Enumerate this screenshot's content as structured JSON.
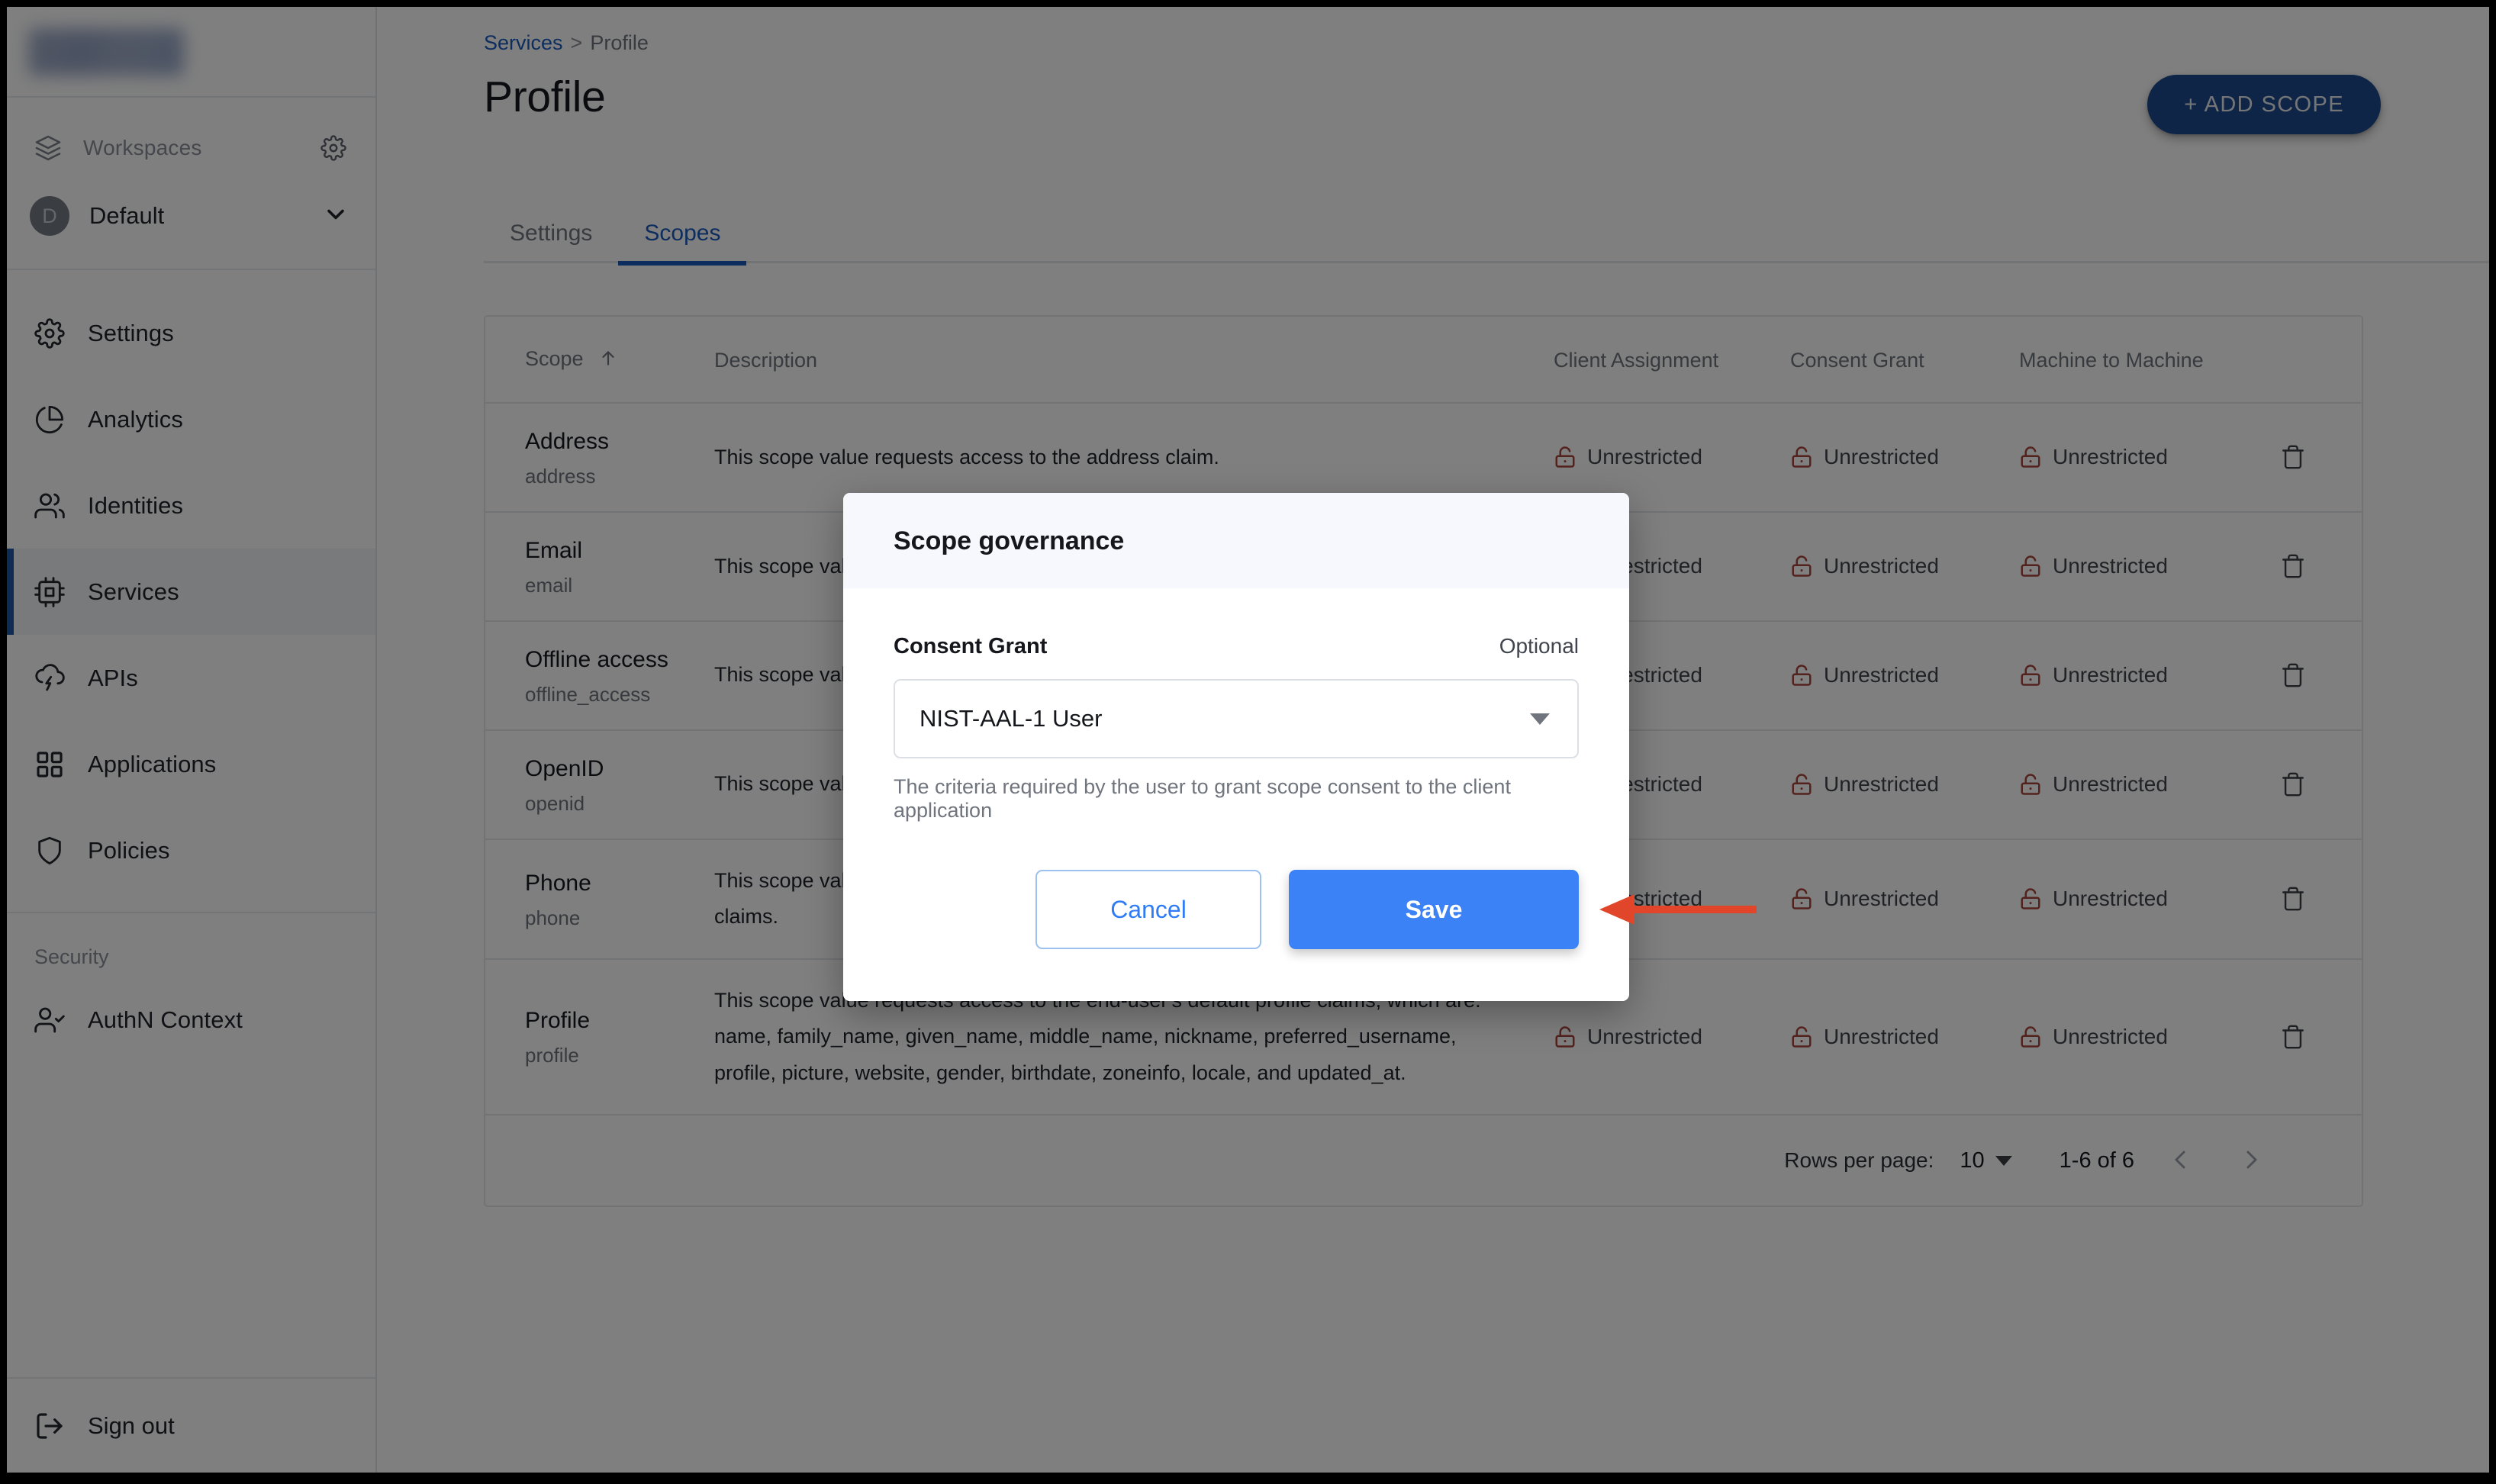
{
  "sidebar": {
    "brand": {
      "logo_name": "app-logo-blurred"
    },
    "workspaces": {
      "label": "Workspaces",
      "gear_icon": "gear-icon",
      "layers_icon": "layers-icon"
    },
    "workspace_selector": {
      "avatar_initial": "D",
      "name": "Default",
      "caret_icon": "chevron-down-icon"
    },
    "nav_items": [
      {
        "label": "Settings",
        "icon": "gear-icon",
        "active": false
      },
      {
        "label": "Analytics",
        "icon": "pie-chart-icon",
        "active": false
      },
      {
        "label": "Identities",
        "icon": "users-icon",
        "active": false
      },
      {
        "label": "Services",
        "icon": "chip-icon",
        "active": true
      },
      {
        "label": "APIs",
        "icon": "cloud-bolt-icon",
        "active": false
      },
      {
        "label": "Applications",
        "icon": "grid-icon",
        "active": false
      },
      {
        "label": "Policies",
        "icon": "shield-icon",
        "active": false
      }
    ],
    "security_section": {
      "title": "Security",
      "items": [
        {
          "label": "AuthN Context",
          "icon": "user-check-icon"
        }
      ]
    },
    "signout": {
      "label": "Sign out",
      "icon": "sign-out-icon"
    }
  },
  "header": {
    "breadcrumb": {
      "parent": "Services",
      "separator": ">",
      "current": "Profile"
    },
    "title": "Profile",
    "add_scope_label": "+ ADD SCOPE"
  },
  "tabs": [
    {
      "label": "Settings",
      "active": false
    },
    {
      "label": "Scopes",
      "active": true
    }
  ],
  "table": {
    "columns": [
      {
        "key": "scope",
        "label": "Scope",
        "sort_icon": "arrow-up-icon",
        "sorted": true
      },
      {
        "key": "description",
        "label": "Description"
      },
      {
        "key": "client_assignment",
        "label": "Client Assignment"
      },
      {
        "key": "consent_grant",
        "label": "Consent Grant"
      },
      {
        "key": "machine_to_machine",
        "label": "Machine to Machine"
      }
    ],
    "unlock_icon": "unlock-icon",
    "delete_icon": "trash-icon",
    "rows": [
      {
        "name": "Address",
        "key": "address",
        "description": "This scope value requests access to the address claim.",
        "client_assignment": "Unrestricted",
        "consent_grant": "Unrestricted",
        "machine_to_machine": "Unrestricted"
      },
      {
        "name": "Email",
        "key": "email",
        "description": "This scope val",
        "client_assignment": "Unrestricted",
        "consent_grant": "Unrestricted",
        "machine_to_machine": "Unrestricted"
      },
      {
        "name": "Offline access",
        "key": "offline_access",
        "description": "This scope val",
        "client_assignment": "Unrestricted",
        "consent_grant": "Unrestricted",
        "machine_to_machine": "Unrestricted"
      },
      {
        "name": "OpenID",
        "key": "openid",
        "description": "This scope val",
        "client_assignment": "Unrestricted",
        "consent_grant": "Unrestricted",
        "machine_to_machine": "Unrestricted"
      },
      {
        "name": "Phone",
        "key": "phone",
        "description": "This scope val\nclaims.",
        "client_assignment": "Unrestricted",
        "consent_grant": "Unrestricted",
        "machine_to_machine": "Unrestricted"
      },
      {
        "name": "Profile",
        "key": "profile",
        "description": "This scope value requests access to the end-user's default profile claims, which are: name, family_name, given_name, middle_name, nickname, preferred_username, profile, picture, website, gender, birthdate, zoneinfo, locale, and updated_at.",
        "client_assignment": "Unrestricted",
        "consent_grant": "Unrestricted",
        "machine_to_machine": "Unrestricted"
      }
    ],
    "footer": {
      "rows_per_page_label": "Rows per page:",
      "rows_per_page_value": "10",
      "range_label": "1-6 of 6",
      "prev_icon": "chevron-left-icon",
      "next_icon": "chevron-right-icon"
    }
  },
  "modal": {
    "title": "Scope governance",
    "field_label": "Consent Grant",
    "field_optional": "Optional",
    "select_value": "NIST-AAL-1 User",
    "select_caret_icon": "caret-down-icon",
    "help_text": "The criteria required by the user to grant scope consent to the client application",
    "cancel_label": "Cancel",
    "save_label": "Save"
  },
  "annotation": {
    "arrow_icon": "left-arrow-annotation",
    "color": "#E2462A",
    "points_at": "Save"
  },
  "colors": {
    "accent_blue": "#1C5BBF",
    "save_blue": "#3B82F6",
    "add_button_blue": "#1E4B8F",
    "unlock_red": "#A8443A",
    "overlay": "rgba(0,0,0,0.5)",
    "modal_header_bg": "#F6F8FD"
  }
}
